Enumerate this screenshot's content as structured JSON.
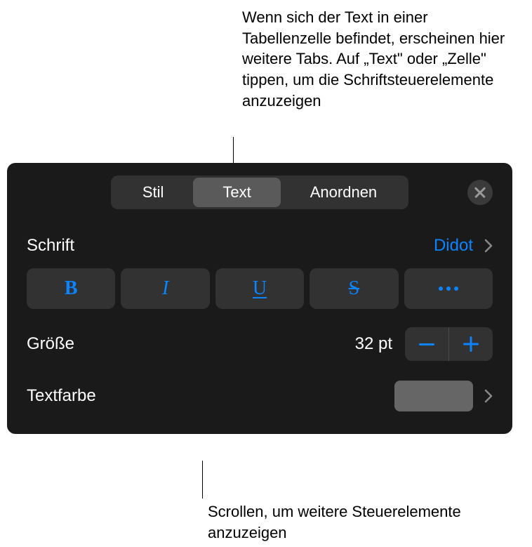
{
  "annotations": {
    "top": "Wenn sich der Text in einer Tabellenzelle befindet, erscheinen hier weitere Tabs. Auf „Text\" oder „Zelle\" tippen, um die Schriftsteuerelemente anzuzeigen",
    "bottom": "Scrollen, um weitere Steuerelemente anzuzeigen"
  },
  "tabs": {
    "stil": "Stil",
    "text": "Text",
    "anordnen": "Anordnen"
  },
  "font": {
    "label": "Schrift",
    "value": "Didot"
  },
  "styleButtons": {
    "bold": "B",
    "italic": "I",
    "underline": "U",
    "strike": "S"
  },
  "size": {
    "label": "Größe",
    "value": "32 pt"
  },
  "textColor": {
    "label": "Textfarbe"
  }
}
